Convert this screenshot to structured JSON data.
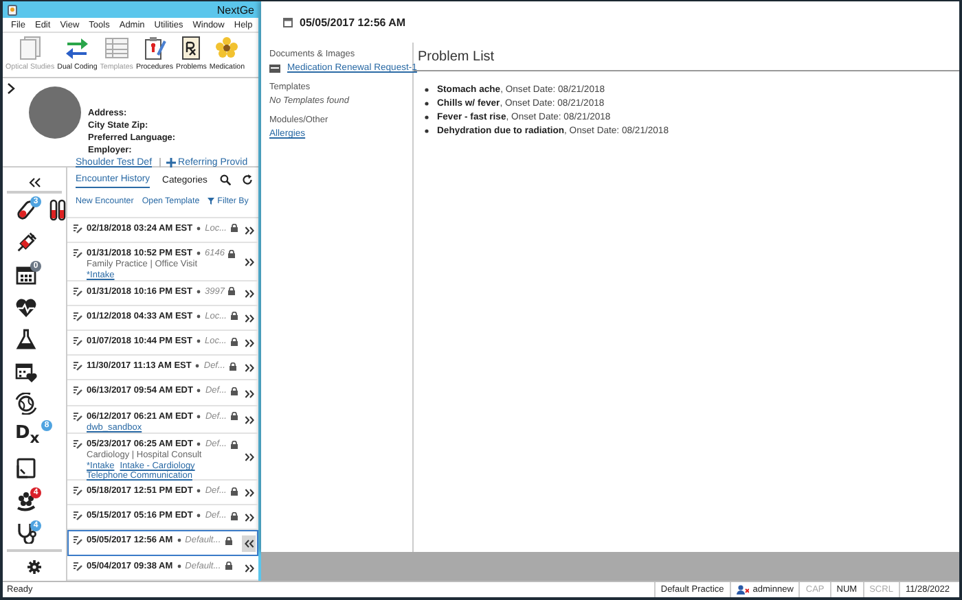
{
  "window": {
    "title": "NextGe"
  },
  "menu": [
    "File",
    "Edit",
    "View",
    "Tools",
    "Admin",
    "Utilities",
    "Window",
    "Help"
  ],
  "toolbar": [
    {
      "kind": "optical",
      "label": "Optical Studies",
      "disabled": true
    },
    {
      "kind": "coding",
      "label": "Dual Coding",
      "disabled": false
    },
    {
      "kind": "templates",
      "label": "Templates",
      "disabled": true
    },
    {
      "kind": "procedures",
      "label": "Procedures",
      "disabled": false
    },
    {
      "kind": "problems",
      "label": "Problems",
      "disabled": false
    },
    {
      "kind": "medication",
      "label": "Medication",
      "disabled": false
    }
  ],
  "patient": {
    "fields": [
      "Address:",
      "City State Zip:",
      "Preferred Language:",
      "Employer:"
    ],
    "links": [
      "Shoulder Test Def",
      "Referring Provid"
    ]
  },
  "sidebar": {
    "items": [
      {
        "kind": "vials",
        "badge": "3",
        "color": "#4fa3e0"
      },
      {
        "kind": "syringe"
      },
      {
        "kind": "calendar",
        "badge": "0",
        "color": "#6b7785"
      },
      {
        "kind": "heart"
      },
      {
        "kind": "flask"
      },
      {
        "kind": "calendar-heart"
      },
      {
        "kind": "globe"
      },
      {
        "kind": "dx",
        "label": "D$_{x}$",
        "badge": "8",
        "color": "#4fa3e0"
      },
      {
        "kind": "document"
      },
      {
        "kind": "flower",
        "badge": "4",
        "color": "#d9202a"
      },
      {
        "kind": "stethoscope",
        "badge": "4",
        "color": "#4fa3e0"
      }
    ]
  },
  "encounters": {
    "tabs": [
      {
        "label": "Encounter History",
        "selected": true
      },
      {
        "label": "Categories",
        "selected": false
      }
    ],
    "actions": [
      "New Encounter",
      "Open Template",
      "Filter By"
    ],
    "rows": [
      {
        "date": "02/18/2018 03:24 AM EST",
        "location": "Loc...",
        "selected": false
      },
      {
        "date": "01/31/2018 10:52 PM EST",
        "location": "6146",
        "details": "Family Practice | Office Visit",
        "links": [
          "*Intake"
        ],
        "selected": false
      },
      {
        "date": "01/31/2018 10:16 PM EST",
        "location": "3997",
        "selected": false
      },
      {
        "date": "01/12/2018 04:33 AM EST",
        "location": "Loc...",
        "selected": false
      },
      {
        "date": "01/07/2018 10:44 PM EST",
        "location": "Loc...",
        "selected": false
      },
      {
        "date": "11/30/2017 11:13 AM EST",
        "location": "Def...",
        "selected": false
      },
      {
        "date": "06/13/2017 09:54 AM EDT",
        "location": "Def...",
        "selected": false
      },
      {
        "date": "06/12/2017 06:21 AM EDT",
        "location": "Def...",
        "links": [
          "dwb_sandbox"
        ],
        "selected": false
      },
      {
        "date": "05/23/2017 06:25 AM EDT",
        "location": "Def...",
        "details": "Cardiology | Hospital Consult",
        "links": [
          "*Intake",
          "Intake - Cardiology",
          "Telephone Communication"
        ],
        "selected": false
      },
      {
        "date": "05/18/2017 12:51 PM EDT",
        "location": "Def...",
        "selected": false
      },
      {
        "date": "05/15/2017 05:16 PM EDT",
        "location": "Def...",
        "selected": false
      },
      {
        "date": "05/05/2017 12:56 AM",
        "location": "Default...",
        "selected": true
      },
      {
        "date": "05/04/2017 09:38 AM",
        "location": "Default...",
        "selected": false
      }
    ]
  },
  "detail": {
    "date": "05/05/2017 12:56 AM",
    "sections": [
      {
        "title": "Documents & Images",
        "items": [
          {
            "kind": "document",
            "text": "Medication Renewal Request-1"
          }
        ]
      },
      {
        "title": "Templates",
        "items": [
          {
            "kind": "empty",
            "text": "No Templates found"
          }
        ]
      },
      {
        "title": "Modules/Other",
        "items": [
          {
            "kind": "link",
            "text": "Allergies"
          }
        ]
      }
    ],
    "problem_list": {
      "title": "Problem List",
      "items": [
        "**Stomach ache**, Onset Date: 08/21/2018",
        "**Chills w/ fever**, Onset Date: 08/21/2018",
        "**Fever - fast rise**, Onset Date: 08/21/2018",
        "**Dehydration due to radiation**, Onset Date: 08/21/2018"
      ]
    }
  },
  "status_bar": {
    "text": "Ready",
    "practice": "Default Practice",
    "user": "adminnew",
    "indicators": [
      {
        "label": "CAP",
        "on": false
      },
      {
        "label": "NUM",
        "on": true
      },
      {
        "label": "SCRL",
        "on": false
      }
    ],
    "date": "11/28/2022"
  }
}
